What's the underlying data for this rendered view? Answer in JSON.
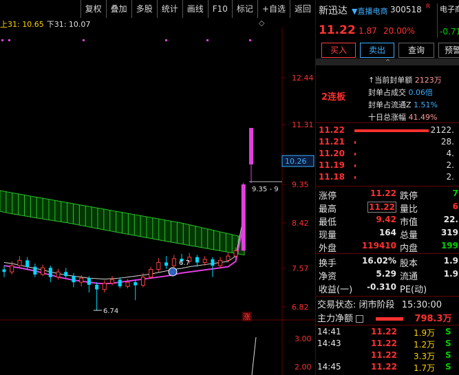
{
  "toolbar": {
    "items": [
      "复权",
      "叠加",
      "多股",
      "统计",
      "画线",
      "F10",
      "标记",
      "+自选",
      "返回"
    ]
  },
  "ma_readout": {
    "upper": "上31: 10.65",
    "lower": "下31: 10.07"
  },
  "diamond": "◇",
  "chart": {
    "price_axis": [
      "12.44",
      "11.31",
      "10.26",
      "9.35",
      "8.42",
      "7.57",
      "6.82"
    ],
    "current_price_tag": "10.26",
    "cursor_label": "9.35 - 9",
    "low_label": "6.74",
    "mid_label": "6.7",
    "zhang_badge": "涨",
    "volume_axis": [
      "3.00",
      "2.00"
    ]
  },
  "chart_data": {
    "type": "candlestick",
    "candles": [
      {
        "o": 7.55,
        "c": 7.5,
        "h": 7.62,
        "l": 7.4
      },
      {
        "o": 7.5,
        "c": 7.62,
        "h": 7.7,
        "l": 7.45
      },
      {
        "o": 7.62,
        "c": 7.72,
        "h": 7.8,
        "l": 7.58
      },
      {
        "o": 7.72,
        "c": 7.6,
        "h": 7.78,
        "l": 7.55
      },
      {
        "o": 7.6,
        "c": 7.45,
        "h": 7.66,
        "l": 7.4
      },
      {
        "o": 7.45,
        "c": 7.58,
        "h": 7.64,
        "l": 7.42
      },
      {
        "o": 7.58,
        "c": 7.4,
        "h": 7.62,
        "l": 7.3
      },
      {
        "o": 7.4,
        "c": 7.5,
        "h": 7.56,
        "l": 7.35
      },
      {
        "o": 7.5,
        "c": 7.42,
        "h": 7.58,
        "l": 7.38
      },
      {
        "o": 7.42,
        "c": 7.3,
        "h": 7.48,
        "l": 7.2
      },
      {
        "o": 7.3,
        "c": 7.38,
        "h": 7.44,
        "l": 7.22
      },
      {
        "o": 7.38,
        "c": 7.25,
        "h": 7.42,
        "l": 7.1
      },
      {
        "o": 7.25,
        "c": 7.16,
        "h": 7.3,
        "l": 6.74
      },
      {
        "o": 7.16,
        "c": 7.28,
        "h": 7.34,
        "l": 7.1
      },
      {
        "o": 7.28,
        "c": 7.35,
        "h": 7.42,
        "l": 7.24
      },
      {
        "o": 7.35,
        "c": 7.22,
        "h": 7.4,
        "l": 7.18
      },
      {
        "o": 7.22,
        "c": 7.3,
        "h": 7.36,
        "l": 7.18
      },
      {
        "o": 7.3,
        "c": 7.24,
        "h": 7.34,
        "l": 6.95
      },
      {
        "o": 7.24,
        "c": 7.4,
        "h": 7.48,
        "l": 7.2
      },
      {
        "o": 7.4,
        "c": 7.55,
        "h": 7.6,
        "l": 7.36
      },
      {
        "o": 7.55,
        "c": 7.68,
        "h": 7.76,
        "l": 7.5
      },
      {
        "o": 7.68,
        "c": 7.62,
        "h": 7.8,
        "l": 7.56
      },
      {
        "o": 7.62,
        "c": 7.75,
        "h": 7.82,
        "l": 7.58
      },
      {
        "o": 7.75,
        "c": 7.7,
        "h": 7.84,
        "l": 7.64
      },
      {
        "o": 7.7,
        "c": 7.78,
        "h": 7.86,
        "l": 7.66
      },
      {
        "o": 7.78,
        "c": 7.68,
        "h": 7.82,
        "l": 7.6
      },
      {
        "o": 7.68,
        "c": 7.74,
        "h": 7.8,
        "l": 7.62
      },
      {
        "o": 7.74,
        "c": 7.62,
        "h": 7.78,
        "l": 7.4
      },
      {
        "o": 7.62,
        "c": 7.72,
        "h": 7.78,
        "l": 7.58
      },
      {
        "o": 7.72,
        "c": 7.8,
        "h": 7.86,
        "l": 7.68
      },
      {
        "o": 7.8,
        "c": 7.9,
        "h": 7.96,
        "l": 7.74
      },
      {
        "o": 7.9,
        "c": 9.35,
        "h": 9.42,
        "l": 7.9
      },
      {
        "o": 10.26,
        "c": 11.22,
        "h": 11.22,
        "l": 9.42
      }
    ]
  },
  "rp": {
    "name": "新迅达",
    "concept": "▼直播电商",
    "code": "300518",
    "r_flag": "R",
    "sector": "电子商",
    "sector_change": "-0.71",
    "price": "11.22",
    "change": "1.87",
    "change_pct": "20.00%",
    "buy": "买入",
    "sell": "卖出",
    "query": "查询",
    "warn": "预警",
    "collapse": "^",
    "lianban": "2连板",
    "seals": [
      {
        "label": "↑当前封单额",
        "value": "2123万",
        "style": "seal-val"
      },
      {
        "label": "封单占成交",
        "value": "0.06倍",
        "style": "seal-val2"
      },
      {
        "label": "封单占流通Z",
        "value": "1.51%",
        "style": "seal-val2"
      },
      {
        "label": "十日总涨幅",
        "value": "41.49%",
        "style": "seal-val"
      }
    ],
    "orderbook": [
      {
        "price": "11.22",
        "vol": "2122.",
        "bar": 1
      },
      {
        "price": "11.21",
        "vol": "28.",
        "bar": 0
      },
      {
        "price": "11.20",
        "vol": "4.",
        "bar": 0
      },
      {
        "price": "11.19",
        "vol": "2.",
        "bar": 0
      },
      {
        "price": "11.18",
        "vol": "2.",
        "bar": 0
      }
    ],
    "quotes": [
      {
        "l1": "涨停",
        "v1": "11.22",
        "c1": "red",
        "b1": false,
        "l2": "跌停",
        "v2": "7",
        "c2": "green"
      },
      {
        "l1": "最高",
        "v1": "11.22",
        "c1": "red",
        "b1": true,
        "l2": "量比",
        "v2": "6",
        "c2": "red"
      },
      {
        "l1": "最低",
        "v1": "9.42",
        "c1": "red",
        "b1": false,
        "l2": "市值",
        "v2": "22.",
        "c2": "white"
      },
      {
        "l1": "现量",
        "v1": "164",
        "c1": "white",
        "b1": false,
        "l2": "总量",
        "v2": "319",
        "c2": "white"
      },
      {
        "l1": "外盘",
        "v1": "119410",
        "c1": "red",
        "b1": false,
        "l2": "内盘",
        "v2": "199",
        "c2": "green"
      }
    ],
    "quotes2": [
      {
        "l1": "换手",
        "v1": "16.02%",
        "c1": "white",
        "l2": "股本",
        "v2": "1.9",
        "c2": "white"
      },
      {
        "l1": "净资",
        "v1": "5.29",
        "c1": "white",
        "l2": "流通",
        "v2": "1.9",
        "c2": "white"
      },
      {
        "l1": "收益(一)",
        "v1": "-0.310",
        "c1": "white",
        "l2": "PE(动)",
        "v2": "",
        "c2": "white"
      }
    ],
    "trade_status_label": "交易状态:",
    "trade_status": "闭市阶段",
    "trade_time": "15:30:00",
    "main_flow_label": "主力净额",
    "main_flow_value": "798.3万",
    "trades": [
      {
        "t": "14:41",
        "p": "11.22",
        "v": "1.9万",
        "s": "S"
      },
      {
        "t": "14:43",
        "p": "11.22",
        "v": "1.2万",
        "s": "S"
      },
      {
        "t": "",
        "p": "11.22",
        "v": "3.3万",
        "s": "S"
      },
      {
        "t": "14:45",
        "p": "11.22",
        "v": "1.7万",
        "s": "S"
      }
    ]
  }
}
